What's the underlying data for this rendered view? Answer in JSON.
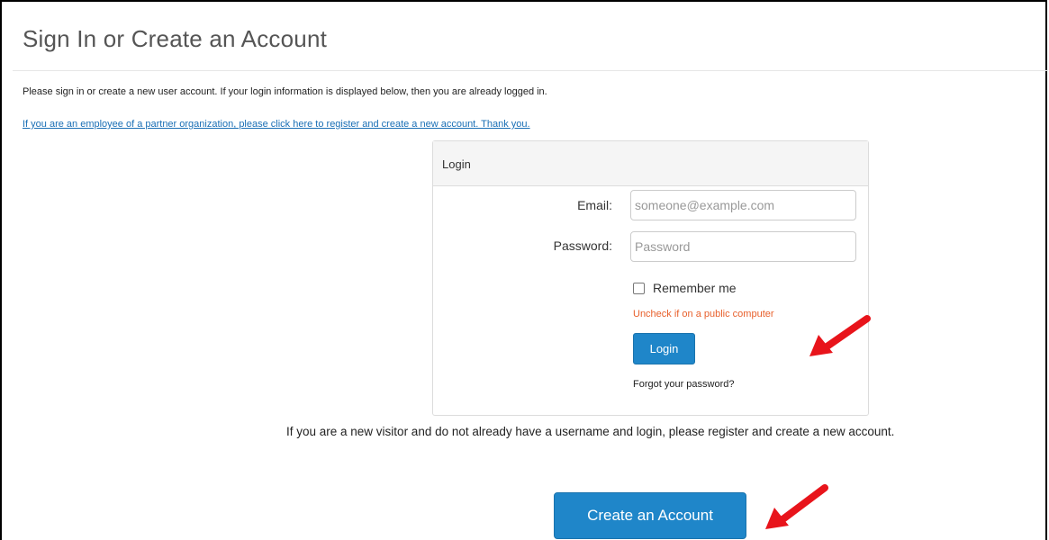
{
  "page": {
    "title": "Sign In or Create an Account",
    "intro": "Please sign in or create a new user account. If your login information is displayed below, then you are already logged in.",
    "partner_link": "If you are an employee of a partner organization, please click here to register and create a new account. Thank you."
  },
  "login_panel": {
    "heading": "Login",
    "email_label": "Email:",
    "email_placeholder": "someone@example.com",
    "email_value": "",
    "password_label": "Password:",
    "password_placeholder": "Password",
    "password_value": "",
    "remember_label": "Remember me",
    "remember_checked": false,
    "uncheck_note": "Uncheck if on a public computer",
    "login_button": "Login",
    "forgot_password": "Forgot your password?"
  },
  "new_visitor_text": "If you are a new visitor and do not already have a username and login, please register and create a new account.",
  "create_account_button": "Create an Account",
  "colors": {
    "button_blue": "#1f86c9",
    "note_orange": "#e8602c",
    "link_blue": "#1a6fb5",
    "annotation_arrow_red": "#e8141b"
  },
  "icons": [
    "red-arrow-annotation-icon",
    "checkbox-icon"
  ]
}
